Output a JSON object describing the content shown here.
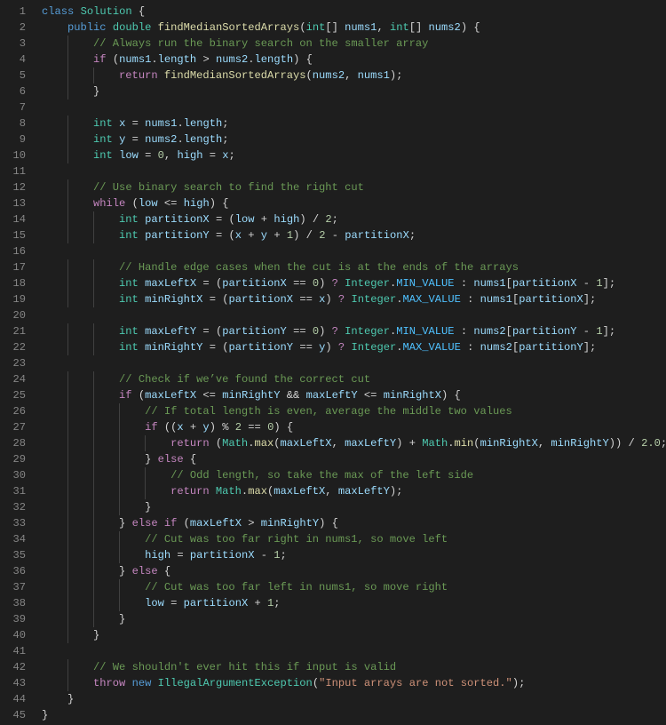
{
  "editor": {
    "language": "java",
    "colors": {
      "background": "#1e1e1e",
      "line_number": "#858585",
      "keyword": "#569cd6",
      "control": "#c586c0",
      "type": "#4ec9b0",
      "function": "#dcdcaa",
      "variable": "#9cdcfe",
      "constant": "#4fc1ff",
      "number": "#b5cea8",
      "string": "#ce9178",
      "comment": "#6a9955"
    },
    "lines": [
      "class Solution {",
      "    public double findMedianSortedArrays(int[] nums1, int[] nums2) {",
      "        // Always run the binary search on the smaller array",
      "        if (nums1.length > nums2.length) {",
      "            return findMedianSortedArrays(nums2, nums1);",
      "        }",
      "",
      "        int x = nums1.length;",
      "        int y = nums2.length;",
      "        int low = 0, high = x;",
      "",
      "        // Use binary search to find the right cut",
      "        while (low <= high) {",
      "            int partitionX = (low + high) / 2;",
      "            int partitionY = (x + y + 1) / 2 - partitionX;",
      "",
      "            // Handle edge cases when the cut is at the ends of the arrays",
      "            int maxLeftX = (partitionX == 0) ? Integer.MIN_VALUE : nums1[partitionX - 1];",
      "            int minRightX = (partitionX == x) ? Integer.MAX_VALUE : nums1[partitionX];",
      "",
      "            int maxLeftY = (partitionY == 0) ? Integer.MIN_VALUE : nums2[partitionY - 1];",
      "            int minRightY = (partitionY == y) ? Integer.MAX_VALUE : nums2[partitionY];",
      "",
      "            // Check if we’ve found the correct cut",
      "            if (maxLeftX <= minRightY && maxLeftY <= minRightX) {",
      "                // If total length is even, average the middle two values",
      "                if ((x + y) % 2 == 0) {",
      "                    return (Math.max(maxLeftX, maxLeftY) + Math.min(minRightX, minRightY)) / 2.0;",
      "                } else {",
      "                    // Odd length, so take the max of the left side",
      "                    return Math.max(maxLeftX, maxLeftY);",
      "                }",
      "            } else if (maxLeftX > minRightY) {",
      "                // Cut was too far right in nums1, so move left",
      "                high = partitionX - 1;",
      "            } else {",
      "                // Cut was too far left in nums1, so move right",
      "                low = partitionX + 1;",
      "            }",
      "        }",
      "",
      "        // We shouldn't ever hit this if input is valid",
      "        throw new IllegalArgumentException(\"Input arrays are not sorted.\");",
      "    }",
      "}"
    ]
  }
}
